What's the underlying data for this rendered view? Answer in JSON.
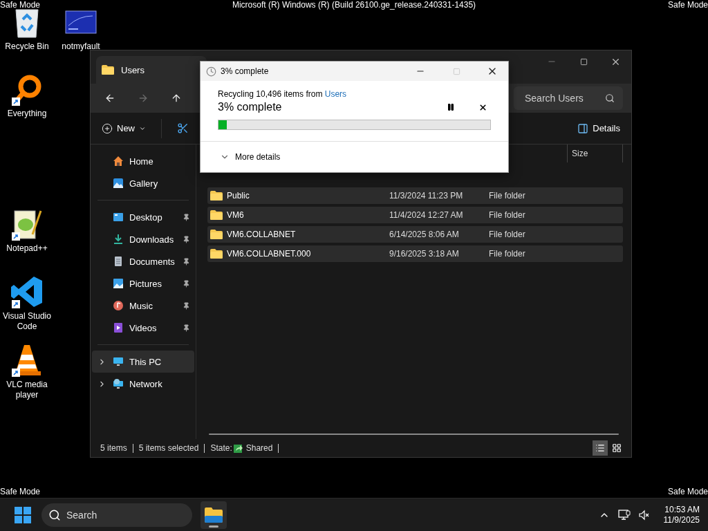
{
  "desktop": {
    "title": "Microsoft (R) Windows (R) (Build 26100.ge_release.240331-1435)",
    "corner_labels": [
      "Safe Mode",
      "Safe Mode",
      "Safe Mode",
      "Safe Mode"
    ],
    "icons": [
      {
        "label": "Recycle Bin",
        "kind": "recycle",
        "shortcut": false
      },
      {
        "label": "notmyfault",
        "kind": "bluescreen",
        "shortcut": false
      },
      {
        "label": "Everything",
        "kind": "everything",
        "shortcut": true
      },
      {
        "label": "Notepad++",
        "kind": "notepad",
        "shortcut": true
      },
      {
        "label": "Visual Studio Code",
        "kind": "vscode",
        "shortcut": true
      },
      {
        "label": "VLC media player",
        "kind": "vlc",
        "shortcut": true
      }
    ]
  },
  "explorer": {
    "tab_title": "Users",
    "search_placeholder": "Search Users",
    "new_label": "New",
    "details_label": "Details",
    "sidebar": [
      {
        "items": [
          {
            "label": "Home",
            "kind": "home",
            "pinned": false,
            "expandable": false,
            "selected": false
          },
          {
            "label": "Gallery",
            "kind": "gallery",
            "pinned": false,
            "expandable": false,
            "selected": false
          }
        ]
      },
      {
        "items": [
          {
            "label": "Desktop",
            "kind": "desktop",
            "pinned": true,
            "expandable": false,
            "selected": false
          },
          {
            "label": "Downloads",
            "kind": "downloads",
            "pinned": true,
            "expandable": false,
            "selected": false
          },
          {
            "label": "Documents",
            "kind": "documents",
            "pinned": true,
            "expandable": false,
            "selected": false
          },
          {
            "label": "Pictures",
            "kind": "pictures",
            "pinned": true,
            "expandable": false,
            "selected": false
          },
          {
            "label": "Music",
            "kind": "music",
            "pinned": true,
            "expandable": false,
            "selected": false
          },
          {
            "label": "Videos",
            "kind": "videos",
            "pinned": true,
            "expandable": false,
            "selected": false
          }
        ]
      },
      {
        "items": [
          {
            "label": "This PC",
            "kind": "pc",
            "pinned": false,
            "expandable": true,
            "selected": true
          },
          {
            "label": "Network",
            "kind": "network",
            "pinned": false,
            "expandable": true,
            "selected": false
          }
        ]
      }
    ],
    "size_header": "Size",
    "rows": [
      {
        "name": "Public",
        "date": "11/3/2024 11:23 PM",
        "type": "File folder",
        "selected": true
      },
      {
        "name": "VM6",
        "date": "11/4/2024 12:27 AM",
        "type": "File folder",
        "selected": true
      },
      {
        "name": "VM6.COLLABNET",
        "date": "6/14/2025 8:06 AM",
        "type": "File folder",
        "selected": true
      },
      {
        "name": "VM6.COLLABNET.000",
        "date": "9/16/2025 3:18 AM",
        "type": "File folder",
        "selected": true
      }
    ],
    "status": {
      "count": "5 items",
      "selection": "5 items selected",
      "state_label": "State:",
      "state_value": "Shared"
    },
    "views": [
      {
        "kind": "details",
        "selected": true
      },
      {
        "kind": "tiles",
        "selected": false
      }
    ]
  },
  "dialog": {
    "title": "3% complete",
    "message": "Recycling 10,496 items from",
    "source_link": "Users",
    "progress_label": "3% complete",
    "level": 0.03,
    "maximize_disabled": true,
    "more_details": "More details"
  },
  "taskbar": {
    "search_placeholder": "Search",
    "explorer_running": true,
    "time": "10:53 AM",
    "date": "11/9/2025"
  }
}
